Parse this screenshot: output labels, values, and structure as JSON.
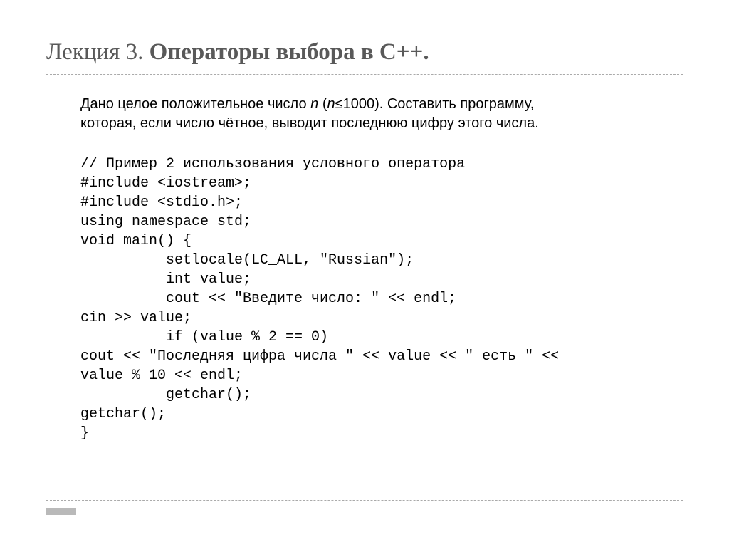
{
  "title": {
    "light": "Лекция 3. ",
    "bold": "Операторы выбора в С++."
  },
  "problem": {
    "line1_before_n": "Дано целое  положительное число ",
    "line1_n1": "n",
    "line1_mid": " (",
    "line1_n2": "n",
    "line1_after": "≤1000). Составить программу,",
    "line2": "которая, если число чётное, выводит последнюю цифру этого числа."
  },
  "code": {
    "l1": "// Пример 2 использования условного оператора",
    "l2": "#include <iostream>;",
    "l3": "#include <stdio.h>;",
    "l4": "using namespace std;",
    "l5": "void main() {",
    "l6": "          setlocale(LC_ALL, \"Russian\");",
    "l7": "          int value;",
    "l8": "          cout << \"Введите число: \" << endl;",
    "l9": "cin >> value;",
    "l10": "          if (value % 2 == 0)",
    "l11": "cout << \"Последняя цифра числа \" << value << \" есть \" <<",
    "l12": "value % 10 << endl;",
    "l13": "          getchar();",
    "l14": "getchar();",
    "l15": "}"
  }
}
